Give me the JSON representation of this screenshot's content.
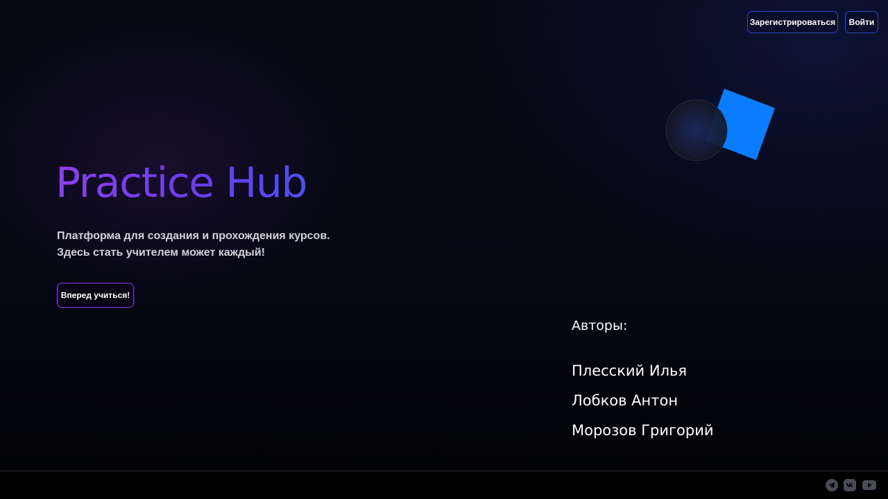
{
  "header": {
    "register_label": "Зарегистрироваться",
    "login_label": "Войти"
  },
  "hero": {
    "title": "Practice Hub",
    "subtitle_lines": [
      "Платформа для создания и прохождения курсов.",
      "Здесь стать учителем может каждый!"
    ],
    "cta_label": "Вперед учиться!"
  },
  "authors": {
    "title": "Авторы:",
    "names": [
      "Плесский Илья",
      "Лобков Антон",
      "Морозов Григорий"
    ]
  },
  "footer": {
    "social_icons": [
      "telegram-icon",
      "vk-icon",
      "youtube-icon"
    ]
  },
  "colors": {
    "background": "#05060d",
    "title_gradient_start": "#8b3ff0",
    "title_gradient_end": "#4d4ef2",
    "header_button_border": "#2d4bc4",
    "cta_border": "#8a3df0",
    "accent_square": "#0a7cff",
    "social_icon": "#4a4c55"
  }
}
